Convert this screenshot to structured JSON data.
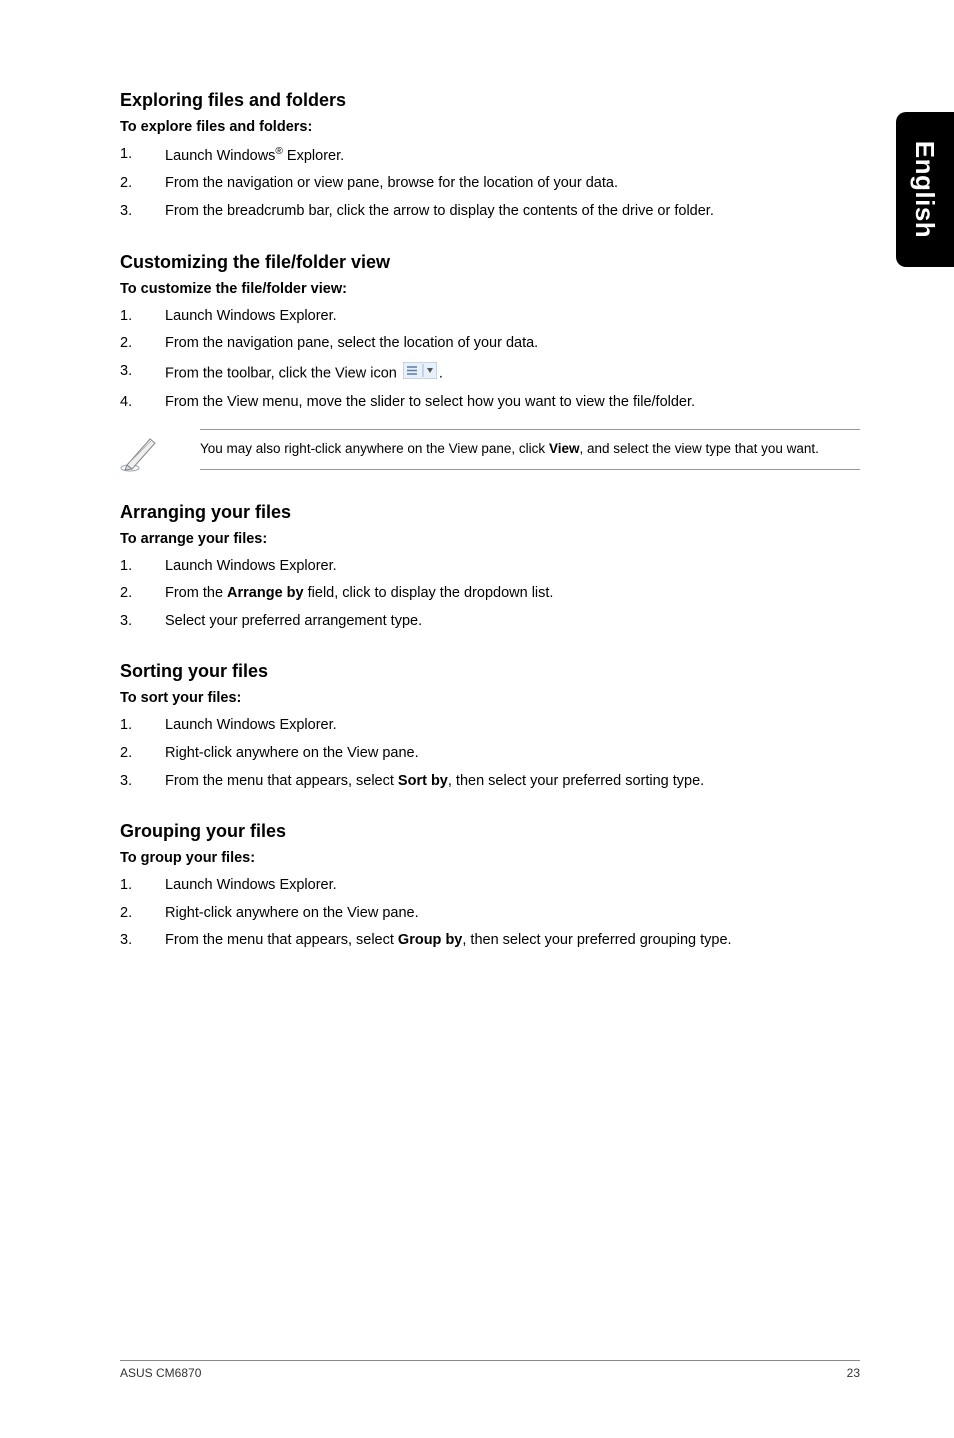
{
  "side_tab": "English",
  "sections": {
    "explore": {
      "heading": "Exploring files and folders",
      "sub": "To explore files and folders:",
      "steps": [
        {
          "n": "1.",
          "pre": "Launch Windows",
          "sup": "®",
          "post": " Explorer."
        },
        {
          "n": "2.",
          "text": "From the navigation or view pane, browse for the location of your data."
        },
        {
          "n": "3.",
          "text": "From the breadcrumb bar, click the arrow to display the contents of the drive or folder."
        }
      ]
    },
    "customize": {
      "heading": "Customizing the file/folder view",
      "sub": "To customize the file/folder view:",
      "steps": [
        {
          "n": "1.",
          "text": "Launch Windows Explorer."
        },
        {
          "n": "2.",
          "text": "From the navigation pane, select the location of your data."
        },
        {
          "n": "3.",
          "pre": "From the toolbar, click the View icon ",
          "icon": true,
          "post": "."
        },
        {
          "n": "4.",
          "text": "From the View menu, move the slider to select how you want to view the file/folder."
        }
      ],
      "note_pre": "You may also right-click anywhere on the View pane, click ",
      "note_bold": "View",
      "note_post": ", and select the view type that you want."
    },
    "arrange": {
      "heading": "Arranging your files",
      "sub": "To arrange your files:",
      "steps": [
        {
          "n": "1.",
          "text": "Launch Windows Explorer."
        },
        {
          "n": "2.",
          "pre": "From the ",
          "bold": "Arrange by",
          "post": " field, click to display the dropdown list."
        },
        {
          "n": "3.",
          "text": "Select your preferred arrangement type."
        }
      ]
    },
    "sort": {
      "heading": "Sorting your files",
      "sub": "To sort your files:",
      "steps": [
        {
          "n": "1.",
          "text": "Launch Windows Explorer."
        },
        {
          "n": "2.",
          "text": "Right-click anywhere on the View pane."
        },
        {
          "n": "3.",
          "pre": "From the menu that appears, select ",
          "bold": "Sort by",
          "post": ", then select your preferred sorting type."
        }
      ]
    },
    "group": {
      "heading": "Grouping your files",
      "sub": "To group your files:",
      "steps": [
        {
          "n": "1.",
          "text": "Launch Windows Explorer."
        },
        {
          "n": "2.",
          "text": "Right-click anywhere on the View pane."
        },
        {
          "n": "3.",
          "pre": "From the menu that appears, select ",
          "bold": "Group by",
          "post": ", then select your preferred grouping type."
        }
      ]
    }
  },
  "footer": {
    "left": "ASUS CM6870",
    "right": "23"
  }
}
